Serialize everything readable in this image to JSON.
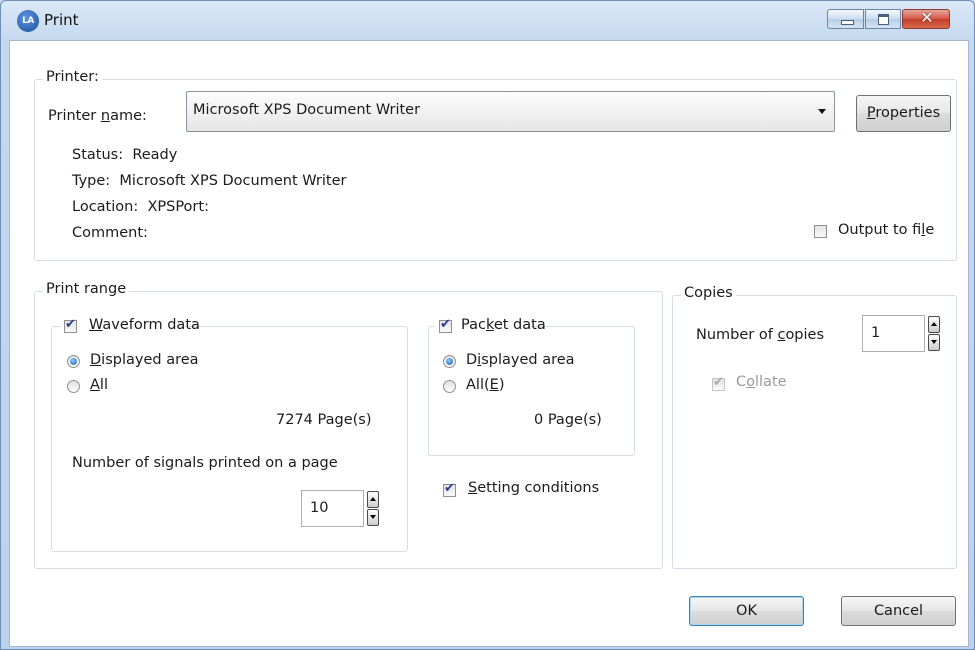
{
  "window": {
    "title": "Print",
    "icon_text": "LA",
    "close_glyph": "✕"
  },
  "printer": {
    "group_label": "Printer:",
    "name_label_pre": "Printer ",
    "name_label_key": "n",
    "name_label_post": "ame:",
    "selected": "Microsoft XPS Document Writer",
    "properties_key": "P",
    "properties_rest": "roperties",
    "status_label": "Status:",
    "status_value": "Ready",
    "type_label": "Type:",
    "type_value": "Microsoft XPS Document Writer",
    "location_label": "Location:",
    "location_value": "XPSPort:",
    "comment_label": "Comment:",
    "output_to_file_pre": "Output to fi",
    "output_to_file_key": "l",
    "output_to_file_post": "e"
  },
  "print_range": {
    "group_label": "Print range",
    "waveform": {
      "key": "W",
      "rest": "aveform data",
      "displayed_key": "D",
      "displayed_rest": "isplayed area",
      "all_key": "A",
      "all_rest": "ll",
      "pages": "7274 Page(s)",
      "signals_label": "Number of signals printed on a page",
      "signals_value": "10"
    },
    "packet": {
      "pre": "Pac",
      "key": "k",
      "post": "et data",
      "displayed_pre": "D",
      "displayed_key": "i",
      "displayed_post": "splayed area",
      "all_pre": "All(",
      "all_key": "E",
      "all_post": ")",
      "pages": "0 Page(s)"
    },
    "setting_key": "S",
    "setting_rest": "etting conditions"
  },
  "copies": {
    "group_label": "Copies",
    "number_pre": "Number of ",
    "number_key": "c",
    "number_post": "opies",
    "number_value": "1",
    "collate_pre": "C",
    "collate_key": "o",
    "collate_post": "llate"
  },
  "buttons": {
    "ok": "OK",
    "cancel": "Cancel"
  }
}
